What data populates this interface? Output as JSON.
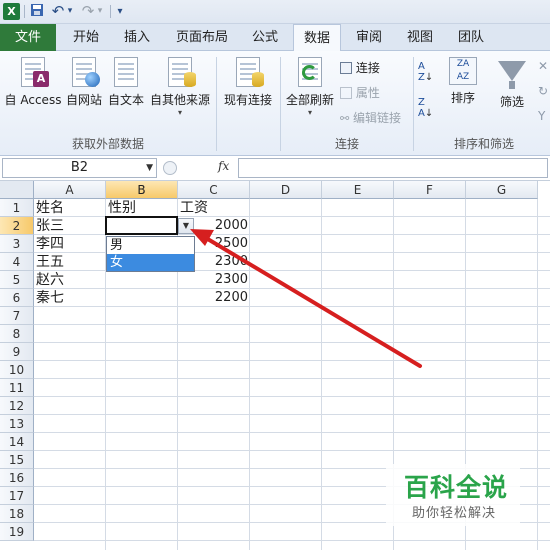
{
  "quick_access": {
    "app_icon": "excel-icon",
    "undo": "↶",
    "redo": "↷",
    "dropdown": "▾"
  },
  "ribbon_tabs": [
    {
      "label": "文件"
    },
    {
      "label": "开始"
    },
    {
      "label": "插入"
    },
    {
      "label": "页面布局"
    },
    {
      "label": "公式"
    },
    {
      "label": "数据"
    },
    {
      "label": "审阅"
    },
    {
      "label": "视图"
    },
    {
      "label": "团队"
    }
  ],
  "ribbon": {
    "external_group": {
      "label": "获取外部数据",
      "buttons": [
        "自 Access",
        "自网站",
        "自文本",
        "自其他来源"
      ]
    },
    "existing_connections": "现有连接",
    "connections_group": {
      "label": "连接",
      "refresh_all": "全部刷新",
      "connections": "连接",
      "properties": "属性",
      "edit_links": "编辑链接"
    },
    "sort_group": {
      "label": "排序和筛选",
      "sort": "排序",
      "filter": "筛选"
    }
  },
  "formula_bar": {
    "name_box": "B2",
    "fx": "fx",
    "content": ""
  },
  "columns": [
    "A",
    "B",
    "C",
    "D",
    "E",
    "F",
    "G"
  ],
  "rows": [
    "1",
    "2",
    "3",
    "4",
    "5",
    "6",
    "7",
    "8",
    "9",
    "10",
    "11",
    "12",
    "13",
    "14",
    "15",
    "16",
    "17",
    "18",
    "19"
  ],
  "cells": {
    "A1": "姓名",
    "B1": "性别",
    "C1": "工资",
    "A2": "张三",
    "C2": "2000",
    "A3": "李四",
    "C3": "2500",
    "A4": "王五",
    "C4": "2300",
    "A5": "赵六",
    "C5": "2300",
    "A6": "秦七",
    "C6": "2200"
  },
  "dropdown_options": [
    "男",
    "女"
  ],
  "watermark": {
    "title": "百科全说",
    "subtitle": "助你轻松解决"
  },
  "colors": {
    "file_tab": "#2f7a3a",
    "selected_header": "#f7c96a",
    "dropdown_highlight": "#3c8be0",
    "arrow": "#d61f1f",
    "watermark": "#2aa44a"
  }
}
